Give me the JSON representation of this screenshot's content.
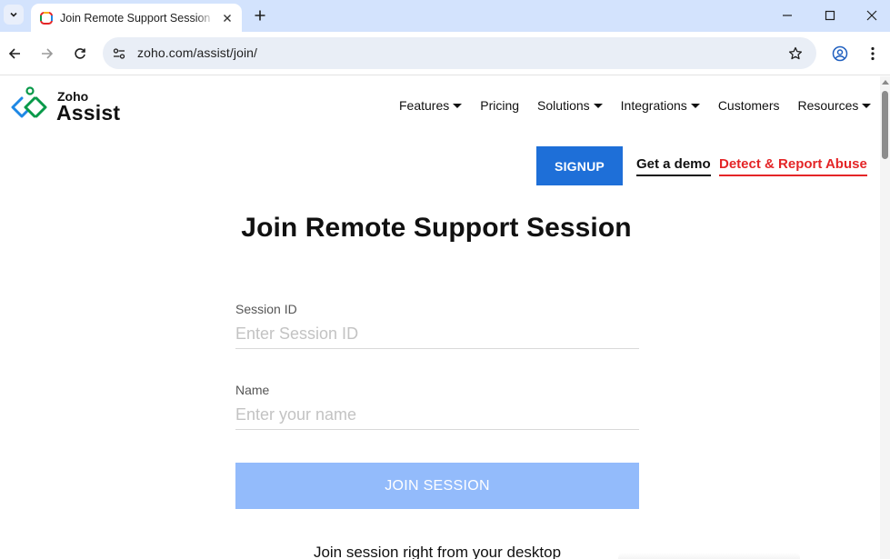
{
  "browser": {
    "tab_title": "Join Remote Support Session | Zoho Assist",
    "url": "zoho.com/assist/join/"
  },
  "header": {
    "logo_small": "Zoho",
    "logo_big": "Assist",
    "nav": [
      {
        "label": "Features",
        "dropdown": true
      },
      {
        "label": "Pricing",
        "dropdown": false
      },
      {
        "label": "Solutions",
        "dropdown": true
      },
      {
        "label": "Integrations",
        "dropdown": true
      },
      {
        "label": "Customers",
        "dropdown": false
      },
      {
        "label": "Resources",
        "dropdown": true
      }
    ],
    "signup": "SIGNUP",
    "demo": "Get a demo",
    "abuse": "Detect & Report Abuse"
  },
  "main": {
    "title": "Join Remote Support Session",
    "session_label": "Session ID",
    "session_placeholder": "Enter Session ID",
    "session_value": "",
    "name_label": "Name",
    "name_placeholder": "Enter your name",
    "name_value": "",
    "join_button": "JOIN SESSION",
    "desktop_text": "Join session right from your desktop"
  },
  "colors": {
    "signup_bg": "#1e6fd8",
    "abuse": "#e42527",
    "join_button_bg": "#93bbfb",
    "tabstrip_bg": "#d3e3fd"
  }
}
